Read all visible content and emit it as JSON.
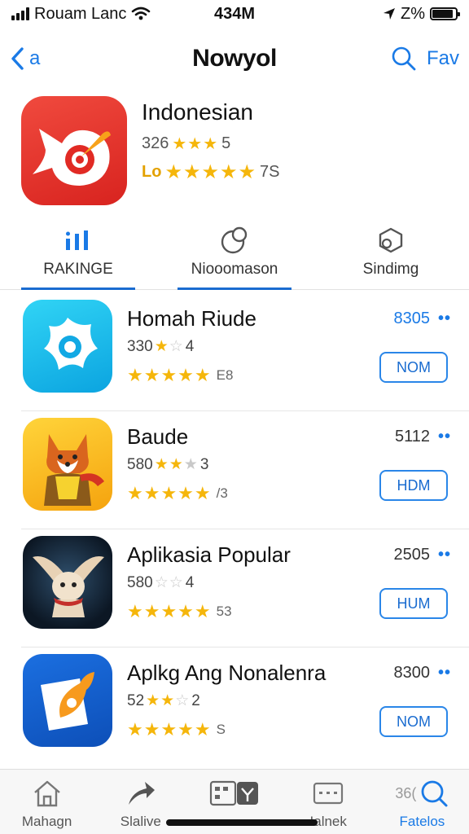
{
  "status": {
    "carrier": "Rouam Lanc",
    "time": "434M",
    "battery_text": "Z%",
    "battery_level": 0.9
  },
  "nav": {
    "back_label": "a",
    "title": "Nowyol",
    "right_label": "Fav"
  },
  "featured": {
    "name": "Indonesian",
    "score_text": "326",
    "score_suffix": "5",
    "rating_prefix": "Lo",
    "rating_count": "7S"
  },
  "tabs": [
    {
      "label": "RAKINGE",
      "icon": "ranking-icon"
    },
    {
      "label": "Niooomason",
      "icon": "chart-pie-icon"
    },
    {
      "label": "Sindimg",
      "icon": "box-icon"
    }
  ],
  "apps": [
    {
      "name": "Homah Riude",
      "score": "330",
      "score_suffix": "4",
      "review_count": "E8",
      "size": "8305",
      "button": "NOM"
    },
    {
      "name": "Baude",
      "score": "580",
      "score_suffix": "3",
      "review_count": "/3",
      "size": "5112",
      "button": "HDM"
    },
    {
      "name": "Aplikasia Popular",
      "score": "580",
      "score_suffix": "4",
      "review_count": "53",
      "size": "2505",
      "button": "HUM"
    },
    {
      "name": "Aplkg Ang Nonalenra",
      "score": "52",
      "score_suffix": "2",
      "review_count": "S",
      "size": "8300",
      "button": "NOM"
    }
  ],
  "tab_bar": {
    "items": [
      {
        "label": "Mahagn",
        "icon": "home-icon"
      },
      {
        "label": "Slalive",
        "icon": "share-arrow-icon"
      },
      {
        "label": "",
        "icon": "apps-icon"
      },
      {
        "label": "Ialnek",
        "icon": "keyboard-icon"
      },
      {
        "label": "Fatelos",
        "icon": "search-icon"
      }
    ],
    "search_prefix": "36("
  },
  "colors": {
    "accent": "#1a7ae6",
    "star": "#f5b60b"
  }
}
